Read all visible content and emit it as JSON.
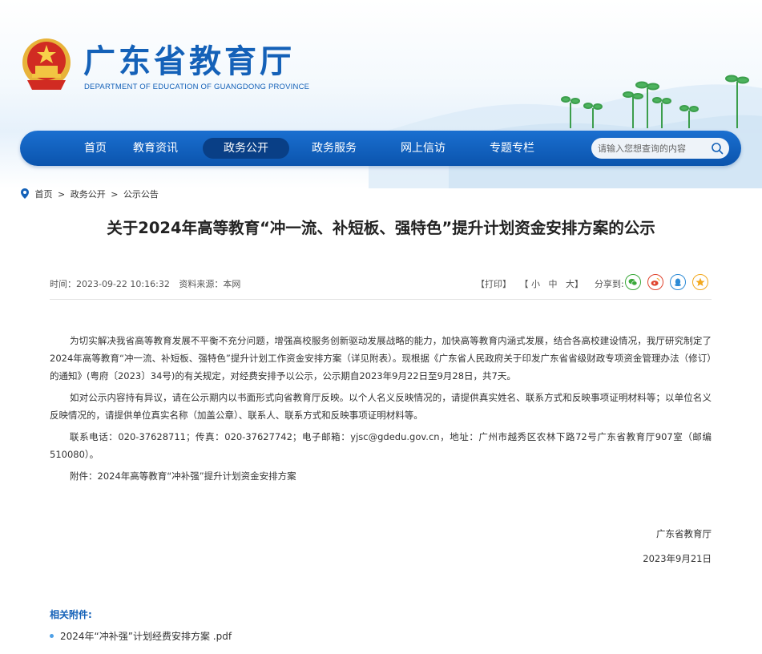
{
  "site": {
    "title": "广东省教育厅",
    "subtitle": "DEPARTMENT OF EDUCATION OF GUANGDONG PROVINCE"
  },
  "nav": {
    "items": [
      {
        "label": "首页"
      },
      {
        "label": "教育资讯"
      },
      {
        "label": "政务公开"
      },
      {
        "label": "政务服务"
      },
      {
        "label": "网上信访"
      },
      {
        "label": "专题专栏"
      }
    ],
    "active": "政务公开",
    "search_placeholder": "请输入您想查询的内容"
  },
  "breadcrumb": [
    "首页",
    "政务公开",
    "公示公告"
  ],
  "breadcrumb_sep": ">",
  "article": {
    "title": "关于2024年高等教育“冲一流、补短板、强特色”提升计划资金安排方案的公示",
    "time_label": "时间：",
    "time": "2023-09-22 10:16:32",
    "source_label": "资料来源：",
    "source": "本网",
    "print": "【打印】",
    "font_open": "【",
    "font_small": "小",
    "font_medium": "中",
    "font_large": "大",
    "font_close": "】",
    "share_label": "分享到:",
    "paragraphs": [
      "为切实解决我省高等教育发展不平衡不充分问题，增强高校服务创新驱动发展战略的能力，加快高等教育内涵式发展，结合各高校建设情况，我厅研究制定了2024年高等教育“冲一流、补短板、强特色”提升计划工作资金安排方案（详见附表）。现根据《广东省人民政府关于印发广东省省级财政专项资金管理办法（修订）的通知》(粤府〔2023〕34号)的有关规定，对经费安排予以公示，公示期自2023年9月22日至9月28日，共7天。",
      "如对公示内容持有异议，请在公示期内以书面形式向省教育厅反映。以个人名义反映情况的，请提供真实姓名、联系方式和反映事项证明材料等；以单位名义反映情况的，请提供单位真实名称（加盖公章）、联系人、联系方式和反映事项证明材料等。",
      "联系电话：020-37628711；传真：020-37627742；电子邮箱：yjsc@gdedu.gov.cn，地址：广州市越秀区农林下路72号广东省教育厅907室（邮编510080）。",
      "附件：2024年高等教育“冲补强”提升计划资金安排方案"
    ],
    "signature": "广东省教育厅",
    "date": "2023年9月21日",
    "attachments_title": "相关附件:",
    "attachments": [
      "2024年“冲补强”计划经费安排方案 .pdf"
    ]
  },
  "icons": {
    "emblem": "national-emblem-icon",
    "search": "search-icon",
    "location": "location-pin-icon",
    "share": [
      "wechat-icon",
      "weibo-icon",
      "qq-icon",
      "qzone-icon"
    ]
  },
  "colors": {
    "brand_blue": "#1461b8",
    "nav_blue": "#0b54ad",
    "nav_active": "#093f86",
    "wechat": "#3aa83a",
    "weibo": "#e0442e",
    "qq": "#2d8bd6",
    "qzone": "#f2a81e"
  }
}
